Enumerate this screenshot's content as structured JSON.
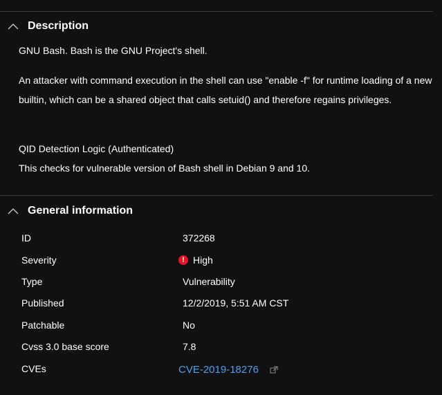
{
  "description_section": {
    "title": "Description",
    "paragraphs": [
      "GNU Bash. Bash is the GNU Project's shell.",
      "An attacker with command execution in the shell can use \"enable -f\" for runtime loading of a new builtin, which can be a shared object that calls setuid() and therefore regains privileges.",
      "QID Detection Logic (Authenticated)",
      "This checks for vulnerable version of Bash shell in Debian 9 and 10."
    ]
  },
  "general_section": {
    "title": "General information",
    "rows": [
      {
        "label": "ID",
        "value": "372268"
      },
      {
        "label": "Severity",
        "value": "High",
        "icon": "error-icon",
        "icon_color": "#e81123"
      },
      {
        "label": "Type",
        "value": "Vulnerability"
      },
      {
        "label": "Published",
        "value": "12/2/2019, 5:51 AM CST"
      },
      {
        "label": "Patchable",
        "value": "No"
      },
      {
        "label": "Cvss 3.0 base score",
        "value": "7.8"
      },
      {
        "label": "CVEs",
        "value": "CVE-2019-18276",
        "link_color": "#4aa0f0",
        "icon": "external-link-icon"
      }
    ]
  },
  "colors": {
    "background": "#111111",
    "divider": "#3d3d3d",
    "text": "#ffffff",
    "link": "#4aa0f0",
    "severity_high": "#e81123"
  }
}
